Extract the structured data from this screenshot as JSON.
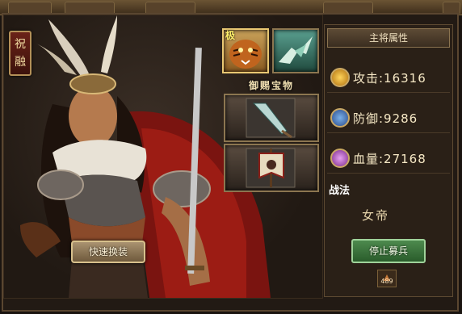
{
  "general_name": "祝融",
  "skill_icons": [
    "tiger-skill-icon",
    "eagle-skill-icon"
  ],
  "skill_badge_char": "极",
  "treasure": {
    "title": "御赐宝物",
    "items": [
      "spear-treasure-icon",
      "banner-treasure-icon"
    ]
  },
  "quick_change_label": "快速换装",
  "attributes": {
    "header": "主将属性",
    "attack": "攻击:16316",
    "defense": "防御:9286",
    "hp": "血量:27168"
  },
  "tactics": {
    "label": "战法",
    "value": "女帝"
  },
  "stop_recruit_label": "停止募兵",
  "recruit_count": "489",
  "colors": {
    "accent_gold": "#c9a865",
    "button_green": "#3a7a3c",
    "badge_red": "#6a2218"
  }
}
